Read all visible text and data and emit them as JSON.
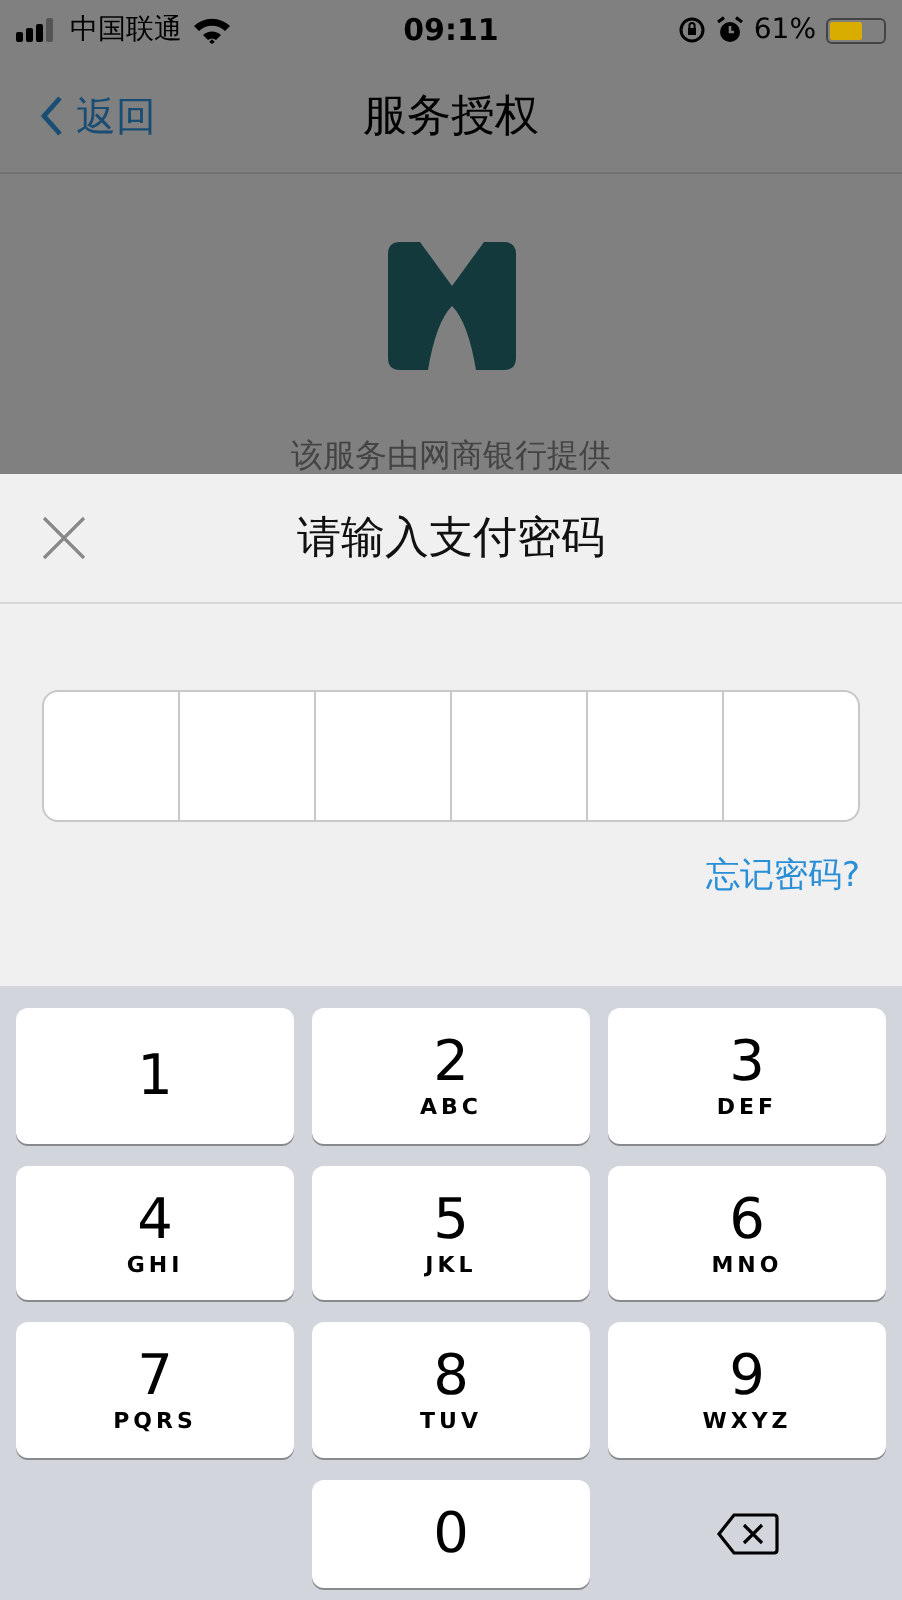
{
  "status_bar": {
    "carrier": "中国联通",
    "time": "09:11",
    "battery": "61%"
  },
  "nav": {
    "back": "返回",
    "title": "服务授权"
  },
  "provider_text": "该服务由网商银行提供",
  "sheet": {
    "title": "请输入支付密码",
    "cells": [
      {
        "filled": false
      },
      {
        "filled": false
      },
      {
        "filled": false
      },
      {
        "filled": false
      },
      {
        "filled": false
      },
      {
        "filled": false
      }
    ],
    "forgot_link": "忘记密码?"
  },
  "keyboard": [
    {
      "kind": "digit",
      "digit": "1"
    },
    {
      "kind": "digit",
      "digit": "2",
      "letters": "ABC"
    },
    {
      "kind": "digit",
      "digit": "3",
      "letters": "DEF"
    },
    {
      "kind": "digit",
      "digit": "4",
      "letters": "GHI"
    },
    {
      "kind": "digit",
      "digit": "5",
      "letters": "JKL"
    },
    {
      "kind": "digit",
      "digit": "6",
      "letters": "MNO"
    },
    {
      "kind": "digit",
      "digit": "7",
      "letters": "PQRS"
    },
    {
      "kind": "digit",
      "digit": "8",
      "letters": "TUV"
    },
    {
      "kind": "digit",
      "digit": "9",
      "letters": "WXYZ"
    },
    {
      "kind": "blank"
    },
    {
      "kind": "digit",
      "digit": "0"
    },
    {
      "kind": "backspace"
    }
  ]
}
